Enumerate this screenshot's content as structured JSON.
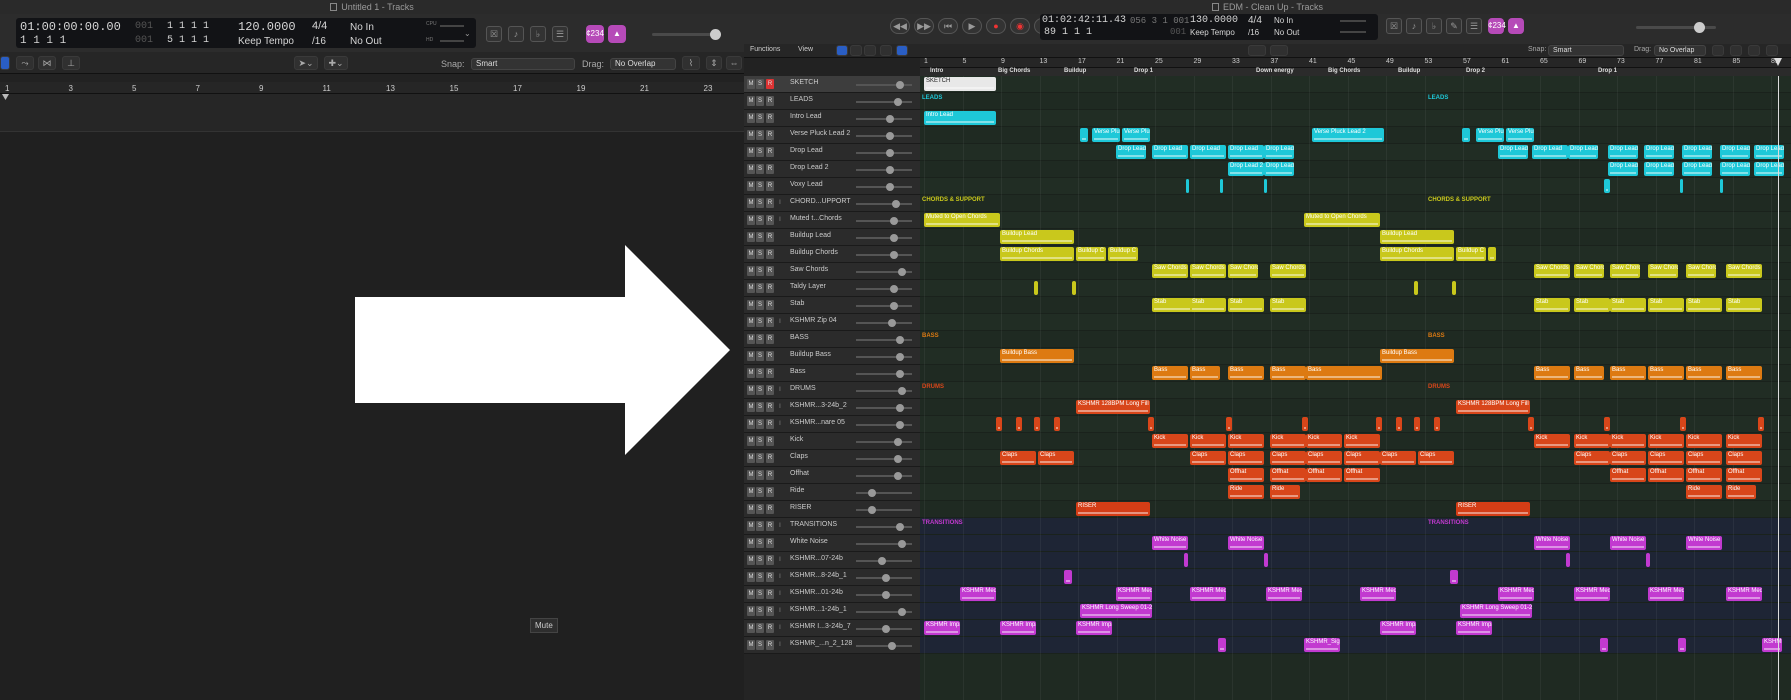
{
  "left_window": {
    "title": "Untitled 1 - Tracks",
    "lcd": {
      "time": "01:00:00:00.00",
      "bars": "1 1 1 1",
      "left_faint": "001",
      "right_faint": "001",
      "bars2": "5 1 1 1",
      "tempo": "120.0000",
      "tempo_mode": "Keep Tempo",
      "sig": "4/4",
      "div": "/16",
      "in": "No In",
      "out": "No Out",
      "cpu": "CPU",
      "hd": "HD"
    },
    "counter_badge": "¢234",
    "snap_label": "Snap:",
    "snap_value": "Smart",
    "drag_label": "Drag:",
    "drag_value": "No Overlap",
    "ruler": [
      "1",
      "3",
      "5",
      "7",
      "9",
      "11",
      "13",
      "15",
      "17",
      "19",
      "21",
      "23"
    ],
    "tooltip": "Mute"
  },
  "right_window": {
    "title": "EDM - Clean Up - Tracks",
    "lcd": {
      "time": "01:02:42:11.43",
      "bars": "89 1 1 1",
      "faint1": "056 3 1 001",
      "faint2": "001",
      "tempo": "130.0000",
      "tempo_mode": "Keep Tempo",
      "sig": "4/4",
      "div": "/16",
      "in": "No In",
      "out": "No Out"
    },
    "counter_badge": "¢234",
    "menu": {
      "functions": "Functions",
      "view": "View"
    },
    "snap_label": "Snap:",
    "snap_value": "Smart",
    "drag_label": "Drag:",
    "drag_value": "No Overlap",
    "ruler": [
      "1",
      "5",
      "9",
      "13",
      "17",
      "21",
      "25",
      "29",
      "33",
      "37",
      "41",
      "45",
      "49",
      "53",
      "57",
      "61",
      "65",
      "69",
      "73",
      "77",
      "81",
      "85",
      "89"
    ],
    "markers": [
      "Intro",
      "Big Chords",
      "Buildup",
      "Drop 1",
      "Down energy",
      "Big Chords",
      "Buildup",
      "Drop 2",
      "Drop 1"
    ],
    "tracks": [
      {
        "name": "SKETCH",
        "r": "R",
        "rec": true
      },
      {
        "name": "LEADS",
        "r": "R"
      },
      {
        "name": "Intro Lead",
        "r": "R"
      },
      {
        "name": "Verse Pluck Lead 2",
        "r": "R"
      },
      {
        "name": "Drop Lead",
        "r": "R"
      },
      {
        "name": "Drop Lead 2",
        "r": "R"
      },
      {
        "name": "Voxy Lead",
        "r": "R"
      },
      {
        "name": "CHORD...UPPORT",
        "r": "R",
        "i": "I"
      },
      {
        "name": "Muted t...Chords",
        "r": "R",
        "i": "I"
      },
      {
        "name": "Buildup Lead",
        "r": "R"
      },
      {
        "name": "Buildup Chords",
        "r": "R"
      },
      {
        "name": "Saw Chords",
        "r": "R"
      },
      {
        "name": "Taldy Layer",
        "r": "R"
      },
      {
        "name": "Stab",
        "r": "R"
      },
      {
        "name": "KSHMR Zip 04",
        "r": "R",
        "i": "I"
      },
      {
        "name": "BASS",
        "r": "R"
      },
      {
        "name": "Buildup Bass",
        "r": "R"
      },
      {
        "name": "Bass",
        "r": "R"
      },
      {
        "name": "DRUMS",
        "r": "R",
        "i": "I"
      },
      {
        "name": "KSHMR...3-24b_2",
        "r": "R",
        "i": "I"
      },
      {
        "name": "KSHMR...nare 05",
        "r": "R",
        "i": "I"
      },
      {
        "name": "Kick",
        "r": "R"
      },
      {
        "name": "Claps",
        "r": "R"
      },
      {
        "name": "Offhat",
        "r": "R"
      },
      {
        "name": "Ride",
        "r": "R"
      },
      {
        "name": "RISER",
        "r": "R"
      },
      {
        "name": "TRANSITIONS",
        "r": "R",
        "i": "I"
      },
      {
        "name": "White Noise",
        "r": "R"
      },
      {
        "name": "KSHMR...07-24b",
        "r": "R",
        "i": "I"
      },
      {
        "name": "KSHMR...8-24b_1",
        "r": "R",
        "i": "I"
      },
      {
        "name": "KSHMR...01-24b",
        "r": "R",
        "i": "I"
      },
      {
        "name": "KSHMR...1-24b_1",
        "r": "R",
        "i": "I"
      },
      {
        "name": "KSHMR I...3-24b_7",
        "r": "R",
        "i": "I"
      },
      {
        "name": "KSHMR_...n_2_128",
        "r": "R",
        "i": "I"
      }
    ],
    "folders": {
      "leads": "LEADS",
      "chords": "CHORDS & SUPPORT",
      "bass": "BASS",
      "drums": "DRUMS",
      "transitions": "TRANSITIONS"
    },
    "colors": {
      "lead": "#1ec8d8",
      "chord": "#c9c81c",
      "bass": "#dd7a12",
      "drum": "#d8461a",
      "riser": "#d43d16",
      "trans": "#c23ad0",
      "sketch": "#e8e8e8"
    },
    "region_labels": {
      "sketch": "SKETCH",
      "intro": "Intro Lead",
      "verse": "Verse Plu",
      "verse2": "Verse Pluck Lead 2",
      "drop": "Drop Lead",
      "drop2": "Drop Lead 2",
      "muted": "Muted to Open Chords",
      "buildlead": "Buildup Lead",
      "buildchords": "Buildup Chords",
      "buildc": "Buildup C",
      "saw": "Saw Chords",
      "stab": "Stab",
      "buildbass": "Buildup Bass",
      "bass": "Bass",
      "kfill": "KSHMR 128BPM Long Fill 0",
      "kick": "Kick",
      "claps": "Claps",
      "offhat": "Offhat",
      "ride": "Ride",
      "riser": "RISER",
      "wnoise": "White Noise",
      "kmedi": "KSHMR Medi",
      "ksweep": "KSHMR Long Sweep 01-24",
      "kimpa": "KSHMR Impa",
      "ksign": "KSHMR_Sign"
    }
  }
}
